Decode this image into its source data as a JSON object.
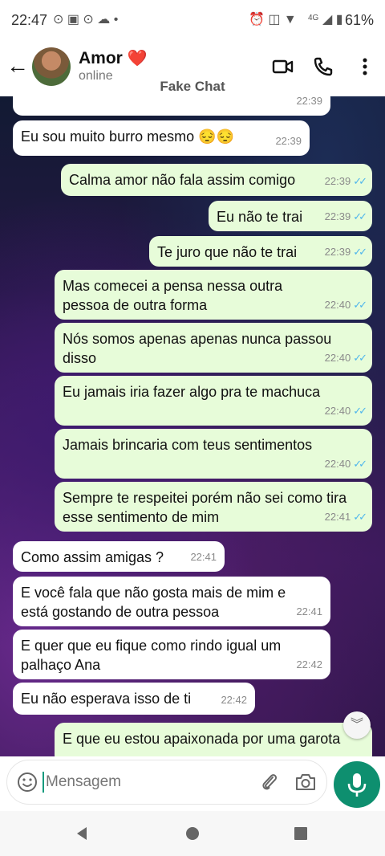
{
  "status_bar": {
    "time": "22:47",
    "network": "4G",
    "battery": "61%"
  },
  "header": {
    "contact_name": "Amor",
    "name_emoji": "❤️",
    "status": "online",
    "app_label": "Fake Chat"
  },
  "messages": [
    {
      "dir": "in",
      "text": "",
      "time": "22:39"
    },
    {
      "dir": "in",
      "text": "Eu sou muito burro mesmo 😔😔",
      "time": "22:39"
    },
    {
      "dir": "out",
      "text": "Calma amor não fala assim comigo",
      "time": "22:39"
    },
    {
      "dir": "out",
      "text": "Eu não te trai",
      "time": "22:39"
    },
    {
      "dir": "out",
      "text": "Te juro que não te trai",
      "time": "22:39"
    },
    {
      "dir": "out",
      "text": "Mas comecei a pensa nessa outra pessoa de outra forma",
      "time": "22:40"
    },
    {
      "dir": "out",
      "text": "Nós somos apenas apenas nunca passou disso",
      "time": "22:40"
    },
    {
      "dir": "out",
      "text": "Eu jamais iria fazer algo pra te machuca",
      "time": "22:40"
    },
    {
      "dir": "out",
      "text": "Jamais brincaria com teus sentimentos",
      "time": "22:40"
    },
    {
      "dir": "out",
      "text": "Sempre te respeitei porém não sei como tira esse sentimento de mim",
      "time": "22:41"
    },
    {
      "dir": "in",
      "text": "Como assim amigas ?",
      "time": "22:41"
    },
    {
      "dir": "in",
      "text": "E você fala que não gosta mais de mim e está gostando de outra pessoa",
      "time": "22:41"
    },
    {
      "dir": "in",
      "text": "E quer que eu fique como rindo igual um palhaço Ana",
      "time": "22:42"
    },
    {
      "dir": "in",
      "text": "Eu não esperava isso de ti",
      "time": "22:42"
    },
    {
      "dir": "out",
      "text": "E que eu estou apaixonada por uma garota",
      "time": ""
    }
  ],
  "input": {
    "placeholder": "Mensagem"
  },
  "colors": {
    "accent": "#0e8f6f",
    "outgoing_bubble": "#e7fcd9",
    "incoming_bubble": "#ffffff",
    "read_tick": "#4fb6ec"
  },
  "icons": [
    "back-arrow-icon",
    "video-call-icon",
    "phone-icon",
    "more-vert-icon",
    "emoji-icon",
    "attach-icon",
    "camera-icon",
    "mic-icon",
    "scroll-down-icon",
    "nav-back-icon",
    "nav-home-icon",
    "nav-recents-icon"
  ]
}
